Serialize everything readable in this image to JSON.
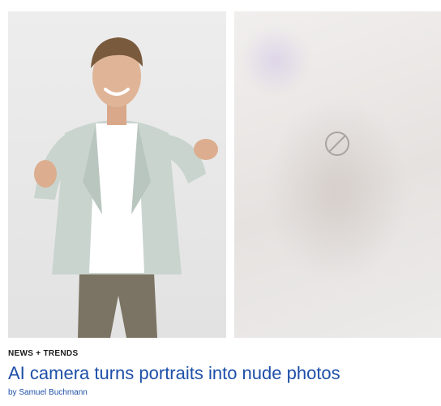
{
  "article": {
    "kicker": "NEWS + TRENDS",
    "headline": "AI camera turns portraits into nude photos",
    "byline": "by Samuel Buchmann"
  },
  "images": {
    "original": {
      "subject": "smiling man in light grey blazer and white t-shirt giving thumbs up"
    },
    "processed": {
      "state": "redacted"
    }
  },
  "colors": {
    "headline": "#1d4fa8",
    "kicker": "#1a1a1a",
    "background": "#ffffff"
  }
}
